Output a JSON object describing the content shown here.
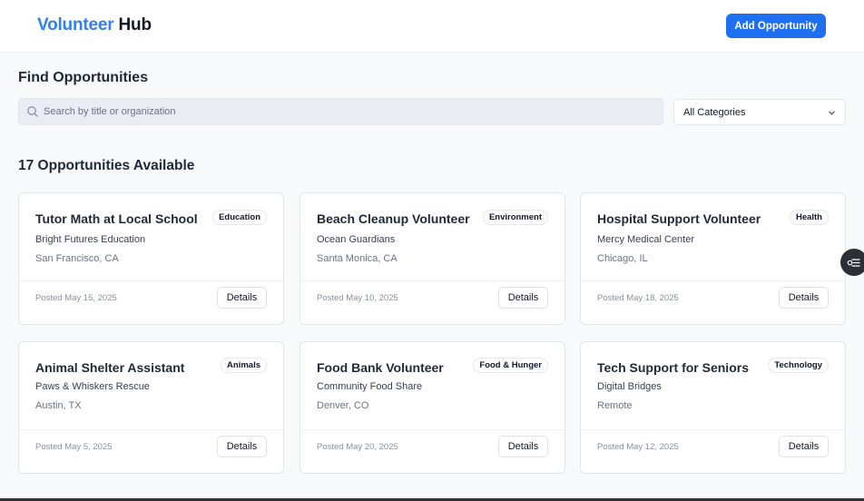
{
  "header": {
    "logo_brand": "Volunteer",
    "logo_rest": "Hub",
    "add_button": "Add Opportunity"
  },
  "filters": {
    "title": "Find Opportunities",
    "search_placeholder": "Search by title or organization",
    "category_selected": "All Categories"
  },
  "results": {
    "count_text": "17 Opportunities Available",
    "cards": [
      {
        "title": "Tutor Math at Local School",
        "category": "Education",
        "organization": "Bright Futures Education",
        "location": "San Francisco, CA",
        "posted": "Posted May 15, 2025",
        "action": "Details"
      },
      {
        "title": "Beach Cleanup Volunteer",
        "category": "Environment",
        "organization": "Ocean Guardians",
        "location": "Santa Monica, CA",
        "posted": "Posted May 10, 2025",
        "action": "Details"
      },
      {
        "title": "Hospital Support Volunteer",
        "category": "Health",
        "organization": "Mercy Medical Center",
        "location": "Chicago, IL",
        "posted": "Posted May 18, 2025",
        "action": "Details"
      },
      {
        "title": "Animal Shelter Assistant",
        "category": "Animals",
        "organization": "Paws & Whiskers Rescue",
        "location": "Austin, TX",
        "posted": "Posted May 5, 2025",
        "action": "Details"
      },
      {
        "title": "Food Bank Volunteer",
        "category": "Food & Hunger",
        "organization": "Community Food Share",
        "location": "Denver, CO",
        "posted": "Posted May 20, 2025",
        "action": "Details"
      },
      {
        "title": "Tech Support for Seniors",
        "category": "Technology",
        "organization": "Digital Bridges",
        "location": "Remote",
        "posted": "Posted May 12, 2025",
        "action": "Details"
      }
    ]
  },
  "colors": {
    "brand": "#2f7ff5",
    "primary_button": "#1f6ff1",
    "background": "#f8f9fb"
  },
  "icons": {
    "search": "search-icon",
    "dropdown": "chevron-down-icon",
    "floating": "filter-list-icon"
  }
}
